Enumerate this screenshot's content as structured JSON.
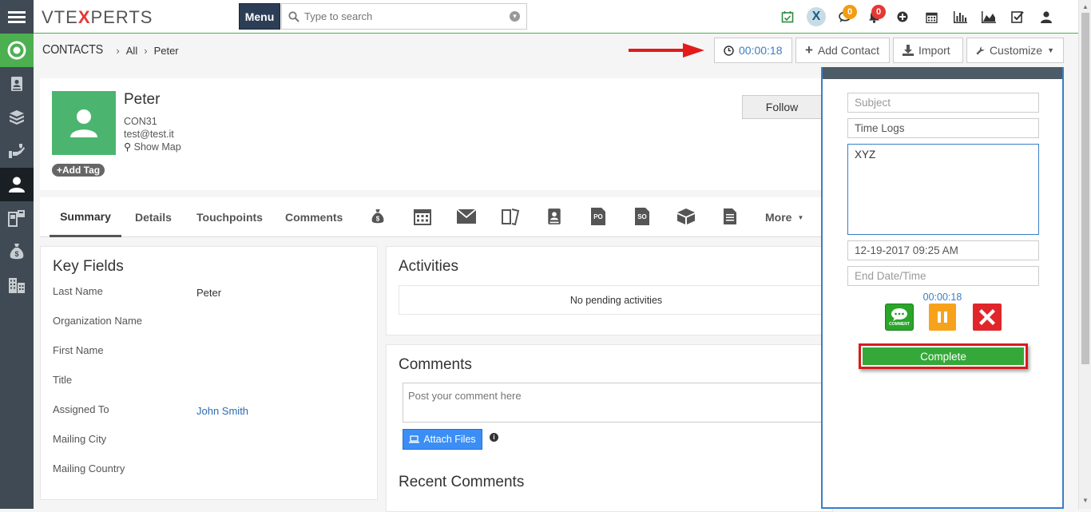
{
  "app": {
    "logo_text_1": "VT",
    "logo_text_2": "E",
    "logo_text_3": "X",
    "logo_text_4": "PERTS"
  },
  "topbar": {
    "menu_label": "Menu",
    "search_placeholder": "Type to search",
    "icons": [
      {
        "name": "calendar-check-icon",
        "glyph": "📅"
      },
      {
        "name": "vtexperts-x-icon",
        "glyph": "X"
      },
      {
        "name": "chat-icon",
        "glyph": "💬",
        "badge": "0"
      },
      {
        "name": "bell-icon",
        "glyph": "🔔",
        "badge": "0"
      },
      {
        "name": "plus-circle-icon",
        "glyph": "⊕"
      },
      {
        "name": "calendar-icon",
        "glyph": "▦"
      },
      {
        "name": "bar-chart-icon",
        "glyph": "▥"
      },
      {
        "name": "area-chart-icon",
        "glyph": "◭"
      },
      {
        "name": "tasks-icon",
        "glyph": "☑"
      },
      {
        "name": "user-icon",
        "glyph": "👤"
      }
    ]
  },
  "sidebar": {
    "items": [
      {
        "name": "home-icon"
      },
      {
        "name": "contacts-book-icon"
      },
      {
        "name": "products-icon"
      },
      {
        "name": "support-icon"
      },
      {
        "name": "contact-user-icon"
      },
      {
        "name": "inventory-icon"
      },
      {
        "name": "money-bag-icon"
      },
      {
        "name": "organization-icon"
      }
    ]
  },
  "breadcrumb": {
    "module": "CONTACTS",
    "all": "All",
    "record": "Peter"
  },
  "actions": {
    "timer": "00:00:18",
    "add_contact": "Add Contact",
    "import": "Import",
    "customize": "Customize"
  },
  "contact": {
    "name": "Peter",
    "id": "CON31",
    "email": "test@test.it",
    "show_map": "Show Map",
    "add_tag": "Add Tag",
    "follow": "Follow"
  },
  "tabs": {
    "summary": "Summary",
    "details": "Details",
    "touchpoints": "Touchpoints",
    "comments": "Comments",
    "more": "More"
  },
  "key_fields": {
    "title": "Key Fields",
    "rows": [
      {
        "label": "Last Name",
        "value": "Peter"
      },
      {
        "label": "Organization Name",
        "value": ""
      },
      {
        "label": "First Name",
        "value": ""
      },
      {
        "label": "Title",
        "value": ""
      },
      {
        "label": "Assigned To",
        "value": "John Smith"
      },
      {
        "label": "Mailing City",
        "value": ""
      },
      {
        "label": "Mailing Country",
        "value": ""
      }
    ]
  },
  "activities": {
    "title": "Activities",
    "empty": "No pending activities"
  },
  "comments": {
    "title": "Comments",
    "placeholder": "Post your comment here",
    "attach": "Attach Files",
    "recent": "Recent Comments"
  },
  "timelog": {
    "subject_placeholder": "Subject",
    "type": "Time Logs",
    "description": "XYZ",
    "start": "12-19-2017 09:25 AM",
    "end_placeholder": "End Date/Time",
    "elapsed": "00:00:18",
    "comment_label": "COMMENT",
    "complete": "Complete"
  }
}
